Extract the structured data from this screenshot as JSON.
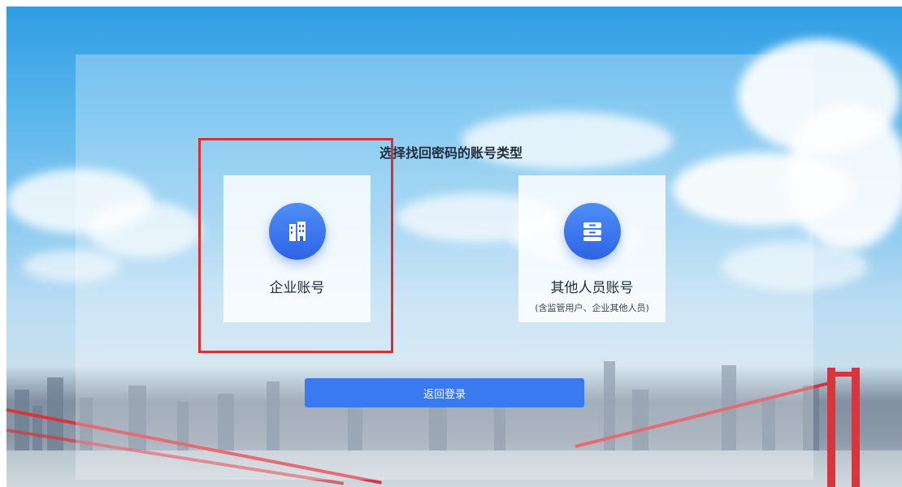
{
  "page": {
    "title": "选择找回密码的账号类型"
  },
  "cards": [
    {
      "label": "企业账号",
      "icon": "building-icon",
      "sub": ""
    },
    {
      "label": "其他人员账号",
      "icon": "archive-cabinet-icon",
      "sub": "(含监管用户、企业其他人员)"
    }
  ],
  "actions": {
    "back_label": "返回登录"
  },
  "colors": {
    "accent": "#3a7af0",
    "highlight": "#e12d2d",
    "icon_bg": "#2d64e6"
  }
}
